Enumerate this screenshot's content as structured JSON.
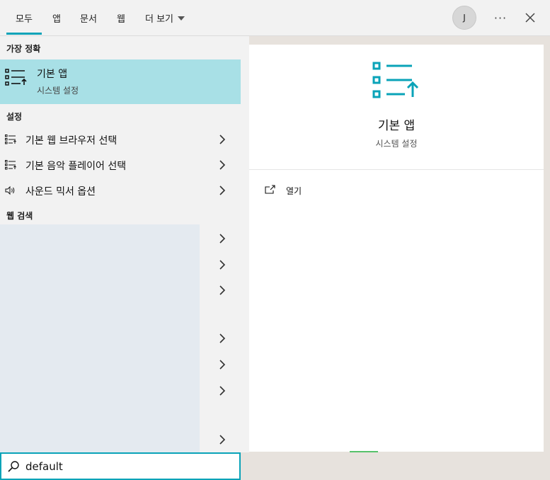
{
  "tabs": [
    {
      "label": "모두"
    },
    {
      "label": "앱"
    },
    {
      "label": "문서"
    },
    {
      "label": "웹"
    },
    {
      "label": "더 보기"
    }
  ],
  "avatar_initial": "J",
  "more_label": "···",
  "best_match": {
    "header": "가장 정확",
    "title": "기본 앱",
    "subtitle": "시스템 설정",
    "icon": "default-apps-icon"
  },
  "settings": {
    "header": "설정",
    "items": [
      {
        "label": "기본 웹 브라우저 선택",
        "icon": "default-apps-icon"
      },
      {
        "label": "기본 음악 플레이어 선택",
        "icon": "default-apps-icon"
      },
      {
        "label": "사운드 믹서 옵션",
        "icon": "speaker-icon"
      }
    ]
  },
  "web_search": {
    "header": "웹 검색"
  },
  "detail": {
    "title": "기본 앱",
    "subtitle": "시스템 설정",
    "open_label": "열기"
  },
  "search": {
    "value": "default"
  },
  "colors": {
    "accent": "#0aa3b8",
    "selection": "#a8e0e6"
  }
}
